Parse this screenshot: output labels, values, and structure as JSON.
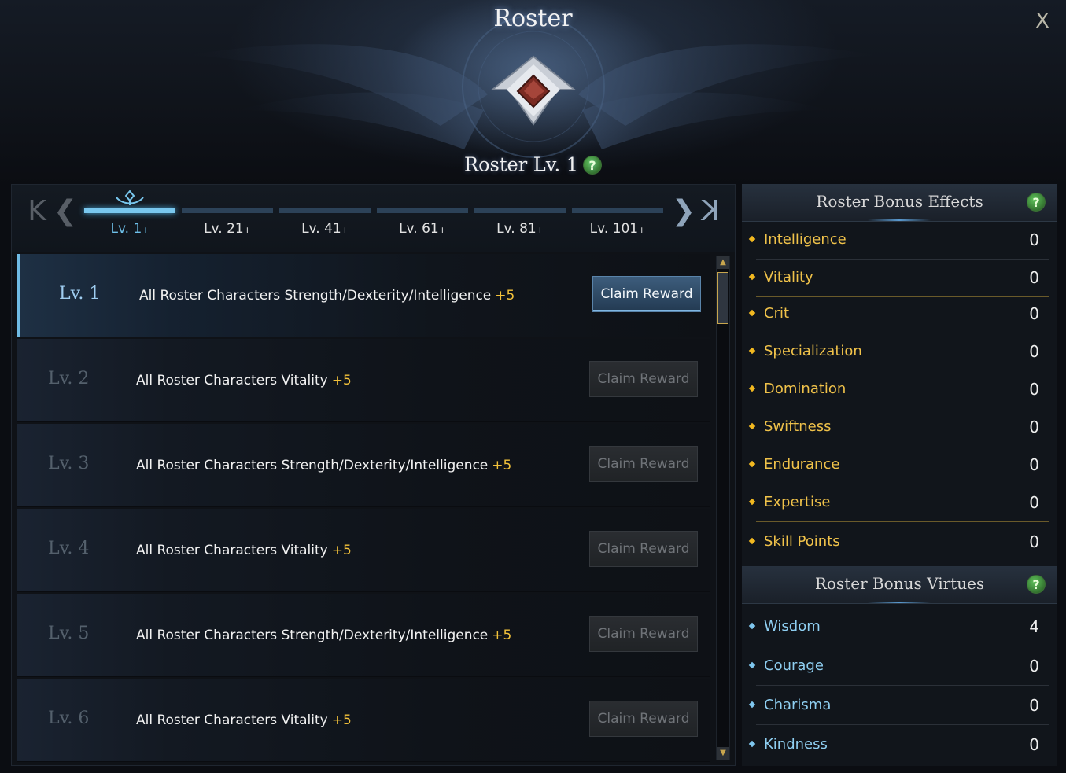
{
  "window": {
    "title": "Roster",
    "close_label": "X"
  },
  "roster": {
    "level_label": "Roster Lv. 1",
    "help_label": "?"
  },
  "tabs": {
    "first_label": "K",
    "prev_label": "❮",
    "next_label": "❯",
    "last_label": "K",
    "items": [
      {
        "label": "Lv. 1",
        "suffix": "+"
      },
      {
        "label": "Lv. 21",
        "suffix": "+"
      },
      {
        "label": "Lv. 41",
        "suffix": "+"
      },
      {
        "label": "Lv. 61",
        "suffix": "+"
      },
      {
        "label": "Lv. 81",
        "suffix": "+"
      },
      {
        "label": "Lv. 101",
        "suffix": "+"
      }
    ]
  },
  "rewards": [
    {
      "level": "Lv. 1",
      "description": "All Roster Characters Strength/Dexterity/Intelligence",
      "bonus": "+5",
      "button": "Claim Reward"
    },
    {
      "level": "Lv. 2",
      "description": "All Roster Characters Vitality",
      "bonus": "+5",
      "button": "Claim Reward"
    },
    {
      "level": "Lv. 3",
      "description": "All Roster Characters Strength/Dexterity/Intelligence",
      "bonus": "+5",
      "button": "Claim Reward"
    },
    {
      "level": "Lv. 4",
      "description": "All Roster Characters Vitality",
      "bonus": "+5",
      "button": "Claim Reward"
    },
    {
      "level": "Lv. 5",
      "description": "All Roster Characters Strength/Dexterity/Intelligence",
      "bonus": "+5",
      "button": "Claim Reward"
    },
    {
      "level": "Lv. 6",
      "description": "All Roster Characters Vitality",
      "bonus": "+5",
      "button": "Claim Reward"
    }
  ],
  "bonus_effects": {
    "title": "Roster Bonus Effects",
    "help_label": "?",
    "items": [
      {
        "name": "Intelligence",
        "value": "0"
      },
      {
        "name": "Vitality",
        "value": "0"
      },
      {
        "name": "Crit",
        "value": "0"
      },
      {
        "name": "Specialization",
        "value": "0"
      },
      {
        "name": "Domination",
        "value": "0"
      },
      {
        "name": "Swiftness",
        "value": "0"
      },
      {
        "name": "Endurance",
        "value": "0"
      },
      {
        "name": "Expertise",
        "value": "0"
      },
      {
        "name": "Skill Points",
        "value": "0"
      }
    ]
  },
  "bonus_virtues": {
    "title": "Roster Bonus Virtues",
    "help_label": "?",
    "items": [
      {
        "name": "Wisdom",
        "value": "4"
      },
      {
        "name": "Courage",
        "value": "0"
      },
      {
        "name": "Charisma",
        "value": "0"
      },
      {
        "name": "Kindness",
        "value": "0"
      }
    ]
  },
  "scrollbar": {
    "up_label": "▲",
    "down_label": "▼"
  },
  "colors": {
    "accent_blue": "#6ec0ea",
    "stat_gold": "#f0c24a",
    "bonus_yellow": "#f2c13a",
    "virtue_blue": "#8fcff2"
  }
}
